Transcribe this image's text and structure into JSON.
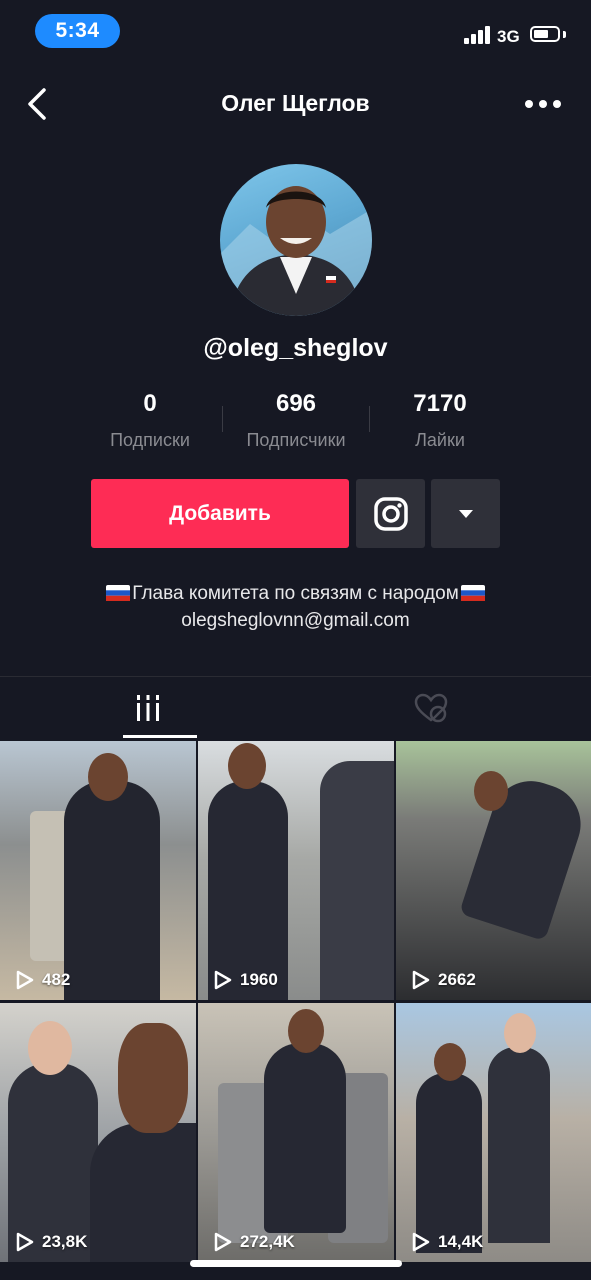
{
  "status_bar": {
    "time": "5:34",
    "network": "3G"
  },
  "nav": {
    "title": "Олег Щеглов"
  },
  "profile": {
    "username": "@oleg_sheglov",
    "stats": [
      {
        "value": "0",
        "label": "Подписки"
      },
      {
        "value": "696",
        "label": "Подписчики"
      },
      {
        "value": "7170",
        "label": "Лайки"
      }
    ],
    "follow_label": "Добавить",
    "bio_line1": "Глава комитета по связям с народом",
    "bio_line2": "olegsheglovnn@gmail.com"
  },
  "videos": [
    {
      "views": "482"
    },
    {
      "views": "1960"
    },
    {
      "views": "2662"
    },
    {
      "views": "23,8K"
    },
    {
      "views": "272,4K"
    },
    {
      "views": "14,4K"
    }
  ],
  "colors": {
    "background": "#161823",
    "accent": "#fe2c55",
    "secondary_button": "#2f3039",
    "time_pill": "#1e8bff"
  },
  "icons": {
    "back": "chevron-left-icon",
    "more": "more-horizontal-icon",
    "instagram": "instagram-icon",
    "dropdown": "caret-down-icon",
    "videos_tab": "grid-icon",
    "liked_tab": "hidden-heart-icon",
    "play": "play-icon",
    "flag": "russia-flag-icon"
  }
}
